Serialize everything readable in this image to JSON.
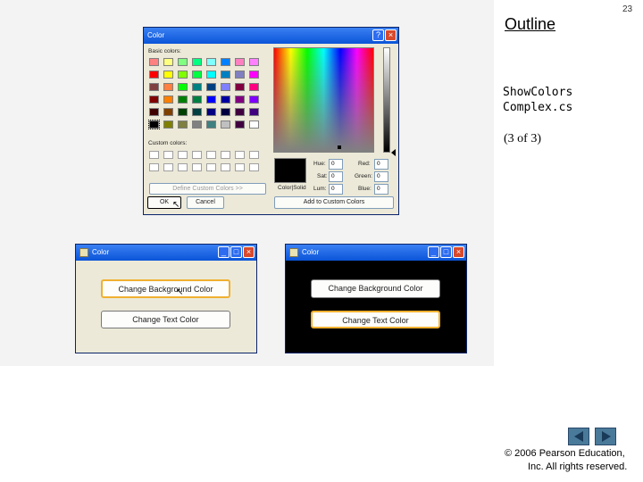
{
  "slide": {
    "page_number": "23",
    "outline_label": "Outline",
    "file_name_line1": "ShowColors",
    "file_name_line2": "Complex.cs",
    "part": "(3 of 3)",
    "copyright_line1": "© 2006 Pearson Education,",
    "copyright_line2": "Inc.  All rights reserved."
  },
  "color_dialog": {
    "title": "Color",
    "basic_colors_label": "Basic colors:",
    "custom_colors_label": "Custom colors:",
    "define_button": "Define Custom Colors >>",
    "ok_button": "OK",
    "cancel_button": "Cancel",
    "add_button": "Add to Custom Colors",
    "color_solid_label": "Color|Solid",
    "hue_label": "Hue:",
    "hue_value": "0",
    "sat_label": "Sat:",
    "sat_value": "0",
    "lum_label": "Lum:",
    "lum_value": "0",
    "red_label": "Red:",
    "red_value": "0",
    "green_label": "Green:",
    "green_value": "0",
    "blue_label": "Blue:",
    "blue_value": "0",
    "basic_colors": [
      "#ff8080",
      "#ffff80",
      "#80ff80",
      "#00ff80",
      "#80ffff",
      "#0080ff",
      "#ff80c0",
      "#ff80ff",
      "#ff0000",
      "#ffff00",
      "#80ff00",
      "#00ff40",
      "#00ffff",
      "#0080c0",
      "#8080c0",
      "#ff00ff",
      "#804040",
      "#ff8040",
      "#00ff00",
      "#008080",
      "#004080",
      "#8080ff",
      "#800040",
      "#ff0080",
      "#800000",
      "#ff8000",
      "#008000",
      "#008040",
      "#0000ff",
      "#0000a0",
      "#800080",
      "#8000ff",
      "#400000",
      "#804000",
      "#004000",
      "#004040",
      "#000080",
      "#000040",
      "#400040",
      "#400080",
      "#000000",
      "#808000",
      "#808040",
      "#808080",
      "#408080",
      "#c0c0c0",
      "#400040",
      "#ffffff"
    ]
  },
  "window_light": {
    "title": "Color",
    "bg_button": "Change Background Color",
    "text_button": "Change Text Color"
  },
  "window_dark": {
    "title": "Color",
    "bg_button": "Change Background Color",
    "text_button": "Change Text Color"
  },
  "colors": {
    "window_light_bg": "#ece9d8",
    "window_dark_bg": "#000000",
    "titlebar": "#0a54d8",
    "nav_arrow": "#4a7a9a"
  },
  "icons": [
    "help-icon",
    "close-icon",
    "minimize-icon",
    "maximize-icon",
    "prev-arrow-icon",
    "next-arrow-icon"
  ]
}
